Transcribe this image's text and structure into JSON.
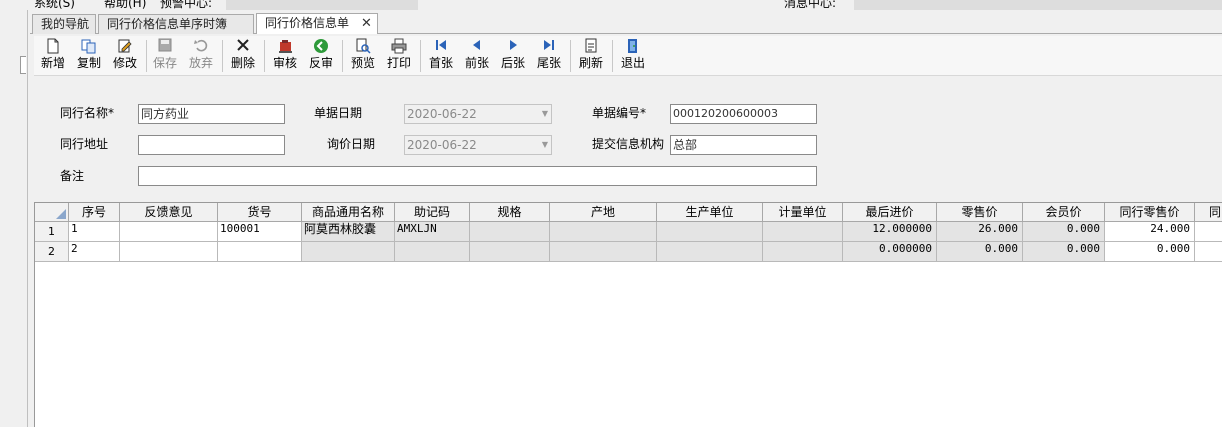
{
  "menubar": {
    "items": [
      "系统(S)",
      "帮助(H)",
      "预警中心:",
      "消息中心:"
    ]
  },
  "tabs": [
    {
      "label": "我的导航",
      "active": false
    },
    {
      "label": "同行价格信息单序时簿",
      "active": false
    },
    {
      "label": "同行价格信息单",
      "active": true,
      "close": "✕"
    }
  ],
  "toolbar": {
    "new": "新增",
    "copy": "复制",
    "edit": "修改",
    "save": "保存",
    "discard": "放弃",
    "delete": "删除",
    "audit": "审核",
    "unaudit": "反审",
    "preview": "预览",
    "print": "打印",
    "first": "首张",
    "prev": "前张",
    "next": "后张",
    "last": "尾张",
    "refresh": "刷新",
    "exit": "退出"
  },
  "form": {
    "peer_name_label": "同行名称*",
    "peer_name_value": "同方药业",
    "doc_date_label": "单据日期",
    "doc_date_value": "2020-06-22",
    "doc_no_label": "单据编号*",
    "doc_no_value": "000120200600003",
    "peer_addr_label": "同行地址",
    "peer_addr_value": "",
    "inquiry_date_label": "询价日期",
    "inquiry_date_value": "2020-06-22",
    "org_label": "提交信息机构",
    "org_value": "总部",
    "remark_label": "备注",
    "remark_value": ""
  },
  "grid": {
    "columns": [
      "序号",
      "反馈意见",
      "货号",
      "商品通用名称",
      "助记码",
      "规格",
      "产地",
      "生产单位",
      "计量单位",
      "最后进价",
      "零售价",
      "会员价",
      "同行零售价",
      "同"
    ],
    "rows": [
      {
        "rowno": "1",
        "seq": "1",
        "feedback": "",
        "item_no": "100001",
        "name": "阿莫西林胶囊",
        "code": "AMXLJN",
        "spec": "",
        "origin": "",
        "maker": "",
        "unit": "",
        "last_price": "12.000000",
        "retail": "26.000",
        "member": "0.000",
        "peer_retail": "24.000"
      },
      {
        "rowno": "2",
        "seq": "2",
        "feedback": "",
        "item_no": "",
        "name": "",
        "code": "",
        "spec": "",
        "origin": "",
        "maker": "",
        "unit": "",
        "last_price": "0.000000",
        "retail": "0.000",
        "member": "0.000",
        "peer_retail": "0.000"
      }
    ]
  },
  "colors": {
    "accent_blue": "#2b63b8",
    "green": "#2e9a3a",
    "red_delete": "#222222"
  }
}
